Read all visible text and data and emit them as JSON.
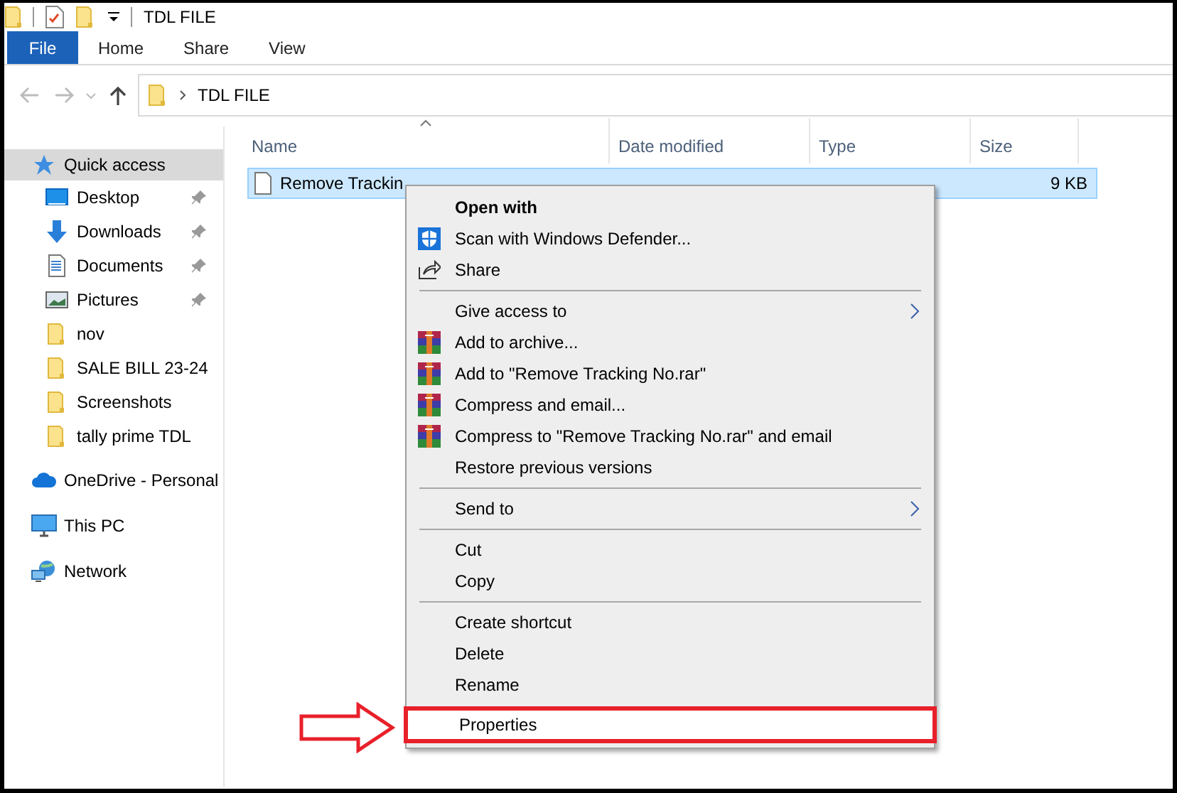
{
  "window": {
    "title": "TDL FILE"
  },
  "ribbon_tabs": [
    {
      "label": "File",
      "kind": "file"
    },
    {
      "label": "Home",
      "kind": "tab"
    },
    {
      "label": "Share",
      "kind": "tab"
    },
    {
      "label": "View",
      "kind": "tab"
    }
  ],
  "address": {
    "folder": "TDL FILE"
  },
  "sidebar": {
    "items": [
      {
        "label": "Quick access",
        "kind": "star",
        "selected": true,
        "children": [
          {
            "label": "Desktop",
            "kind": "desktop",
            "pinned": true,
            "selected": false
          },
          {
            "label": "Downloads",
            "kind": "download",
            "pinned": true,
            "selected": false
          },
          {
            "label": "Documents",
            "kind": "documents",
            "pinned": true,
            "selected": false
          },
          {
            "label": "Pictures",
            "kind": "pictures",
            "pinned": true,
            "selected": false
          },
          {
            "label": "nov",
            "kind": "folder",
            "pinned": false,
            "selected": false
          },
          {
            "label": "SALE BILL 23-24",
            "kind": "folder",
            "pinned": false,
            "selected": false
          },
          {
            "label": "Screenshots",
            "kind": "folder",
            "pinned": false,
            "selected": false
          },
          {
            "label": "tally prime TDL",
            "kind": "folder",
            "pinned": false,
            "selected": false
          }
        ]
      },
      {
        "label": "OneDrive - Personal",
        "kind": "cloud",
        "selected": false
      },
      {
        "label": "This PC",
        "kind": "pc",
        "selected": false
      },
      {
        "label": "Network",
        "kind": "network",
        "selected": false
      }
    ]
  },
  "table": {
    "columns": [
      {
        "label": "Name",
        "sorted": true
      },
      {
        "label": "Date modified",
        "sorted": false
      },
      {
        "label": "Type",
        "sorted": false
      },
      {
        "label": "Size",
        "sorted": false
      }
    ],
    "rows": [
      {
        "name": "Remove Trackin",
        "size": "9 KB",
        "selected": true
      }
    ]
  },
  "context_menu": {
    "groups": [
      {
        "items": [
          {
            "label": "Open with",
            "kind": "plain",
            "default": true,
            "submenu": false,
            "marked": false
          },
          {
            "label": "Scan with Windows Defender...",
            "kind": "shield",
            "default": false,
            "submenu": false,
            "marked": false
          },
          {
            "label": "Share",
            "kind": "share",
            "default": false,
            "submenu": false,
            "marked": false
          }
        ]
      },
      {
        "items": [
          {
            "label": "Give access to",
            "kind": "plain",
            "default": false,
            "submenu": true,
            "marked": false
          },
          {
            "label": "Add to archive...",
            "kind": "archive",
            "default": false,
            "submenu": false,
            "marked": false
          },
          {
            "label": "Add to \"Remove Tracking No.rar\"",
            "kind": "archive",
            "default": false,
            "submenu": false,
            "marked": false
          },
          {
            "label": "Compress and email...",
            "kind": "archive",
            "default": false,
            "submenu": false,
            "marked": false
          },
          {
            "label": "Compress to \"Remove Tracking No.rar\" and email",
            "kind": "archive",
            "default": false,
            "submenu": false,
            "marked": false
          },
          {
            "label": "Restore previous versions",
            "kind": "plain",
            "default": false,
            "submenu": false,
            "marked": false
          }
        ]
      },
      {
        "items": [
          {
            "label": "Send to",
            "kind": "plain",
            "default": false,
            "submenu": true,
            "marked": false
          }
        ]
      },
      {
        "items": [
          {
            "label": "Cut",
            "kind": "plain",
            "default": false,
            "submenu": false,
            "marked": false
          },
          {
            "label": "Copy",
            "kind": "plain",
            "default": false,
            "submenu": false,
            "marked": false
          }
        ]
      },
      {
        "items": [
          {
            "label": "Create shortcut",
            "kind": "plain",
            "default": false,
            "submenu": false,
            "marked": false
          },
          {
            "label": "Delete",
            "kind": "plain",
            "default": false,
            "submenu": false,
            "marked": false
          },
          {
            "label": "Rename",
            "kind": "plain",
            "default": false,
            "submenu": false,
            "marked": false
          },
          {
            "label": "Properties",
            "kind": "plain",
            "default": false,
            "submenu": false,
            "marked": true
          }
        ]
      }
    ]
  }
}
